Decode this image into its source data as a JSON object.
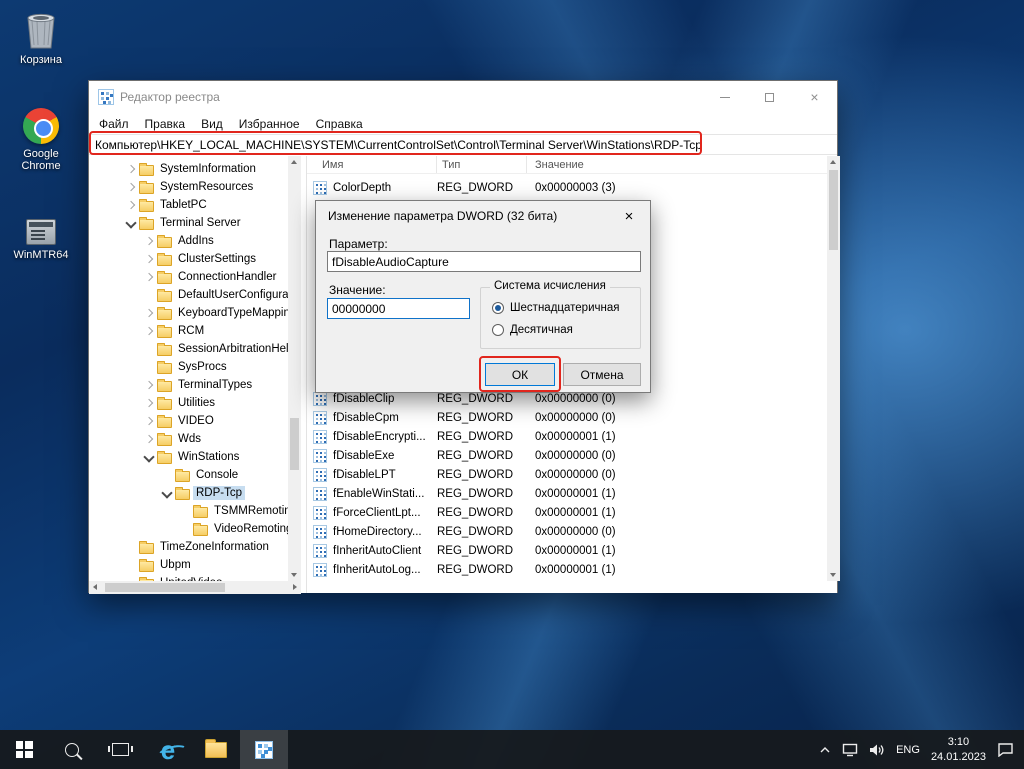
{
  "desktop": {
    "icons": [
      {
        "label": "Корзина"
      },
      {
        "label": "Google Chrome"
      },
      {
        "label": "WinMTR64"
      }
    ]
  },
  "window": {
    "title": "Редактор реестра",
    "menu": [
      {
        "label": "Файл"
      },
      {
        "label": "Правка"
      },
      {
        "label": "Вид"
      },
      {
        "label": "Избранное"
      },
      {
        "label": "Справка"
      }
    ],
    "address": "Компьютер\\HKEY_LOCAL_MACHINE\\SYSTEM\\CurrentControlSet\\Control\\Terminal Server\\WinStations\\RDP-Tcp"
  },
  "tree": {
    "items": [
      {
        "label": "SystemInformation",
        "level": 0,
        "chevron": "collapsed"
      },
      {
        "label": "SystemResources",
        "level": 0,
        "chevron": "collapsed"
      },
      {
        "label": "TabletPC",
        "level": 0,
        "chevron": "collapsed"
      },
      {
        "label": "Terminal Server",
        "level": 0,
        "chevron": "expanded"
      },
      {
        "label": "AddIns",
        "level": 1,
        "chevron": "collapsed"
      },
      {
        "label": "ClusterSettings",
        "level": 1,
        "chevron": "collapsed"
      },
      {
        "label": "ConnectionHandler",
        "level": 1,
        "chevron": "collapsed"
      },
      {
        "label": "DefaultUserConfiguration",
        "level": 1,
        "chevron": "none"
      },
      {
        "label": "KeyboardTypeMapping",
        "level": 1,
        "chevron": "collapsed"
      },
      {
        "label": "RCM",
        "level": 1,
        "chevron": "collapsed"
      },
      {
        "label": "SessionArbitrationHelper",
        "level": 1,
        "chevron": "none"
      },
      {
        "label": "SysProcs",
        "level": 1,
        "chevron": "none"
      },
      {
        "label": "TerminalTypes",
        "level": 1,
        "chevron": "collapsed"
      },
      {
        "label": "Utilities",
        "level": 1,
        "chevron": "collapsed"
      },
      {
        "label": "VIDEO",
        "level": 1,
        "chevron": "collapsed"
      },
      {
        "label": "Wds",
        "level": 1,
        "chevron": "collapsed"
      },
      {
        "label": "WinStations",
        "level": 1,
        "chevron": "expanded"
      },
      {
        "label": "Console",
        "level": 2,
        "chevron": "none"
      },
      {
        "label": "RDP-Tcp",
        "level": 2,
        "chevron": "expanded",
        "selected": true
      },
      {
        "label": "TSMMRemoting",
        "level": 3,
        "chevron": "none"
      },
      {
        "label": "VideoRemoting",
        "level": 3,
        "chevron": "none"
      },
      {
        "label": "TimeZoneInformation",
        "level": 0,
        "chevron": "none"
      },
      {
        "label": "Ubpm",
        "level": 0,
        "chevron": "none"
      },
      {
        "label": "UnitedVideo",
        "level": 0,
        "chevron": "none"
      }
    ]
  },
  "list": {
    "columns": [
      {
        "label": "Имя"
      },
      {
        "label": "Тип"
      },
      {
        "label": "Значение"
      }
    ],
    "top_rows": [
      {
        "name": "ColorDepth",
        "type": "REG_DWORD",
        "value": "0x00000003 (3)"
      }
    ],
    "bottom_rows": [
      {
        "name": "fDisableClip",
        "type": "REG_DWORD",
        "value": "0x00000000 (0)"
      },
      {
        "name": "fDisableCpm",
        "type": "REG_DWORD",
        "value": "0x00000000 (0)"
      },
      {
        "name": "fDisableEncrypti...",
        "type": "REG_DWORD",
        "value": "0x00000001 (1)"
      },
      {
        "name": "fDisableExe",
        "type": "REG_DWORD",
        "value": "0x00000000 (0)"
      },
      {
        "name": "fDisableLPT",
        "type": "REG_DWORD",
        "value": "0x00000000 (0)"
      },
      {
        "name": "fEnableWinStati...",
        "type": "REG_DWORD",
        "value": "0x00000001 (1)"
      },
      {
        "name": "fForceClientLpt...",
        "type": "REG_DWORD",
        "value": "0x00000001 (1)"
      },
      {
        "name": "fHomeDirectory...",
        "type": "REG_DWORD",
        "value": "0x00000000 (0)"
      },
      {
        "name": "fInheritAutoClient",
        "type": "REG_DWORD",
        "value": "0x00000001 (1)"
      },
      {
        "name": "fInheritAutoLog...",
        "type": "REG_DWORD",
        "value": "0x00000001 (1)"
      }
    ]
  },
  "dialog": {
    "title": "Изменение параметра DWORD (32 бита)",
    "close_glyph": "×",
    "param_label": "Параметр:",
    "param_value": "fDisableAudioCapture",
    "value_label": "Значение:",
    "value_text": "00000000",
    "group_label": "Система исчисления",
    "radio_hex": "Шестнадцатеричная",
    "radio_dec": "Десятичная",
    "ok": "ОК",
    "cancel": "Отмена"
  },
  "chrome_controls": {
    "minimize": "–",
    "close": "×"
  },
  "taskbar": {
    "language": "ENG",
    "time": "3:10",
    "date": "24.01.2023"
  },
  "colors": {
    "annotation_red": "#e1261d",
    "selection_blue": "#c7ddf0",
    "default_button_border": "#0078d7"
  }
}
